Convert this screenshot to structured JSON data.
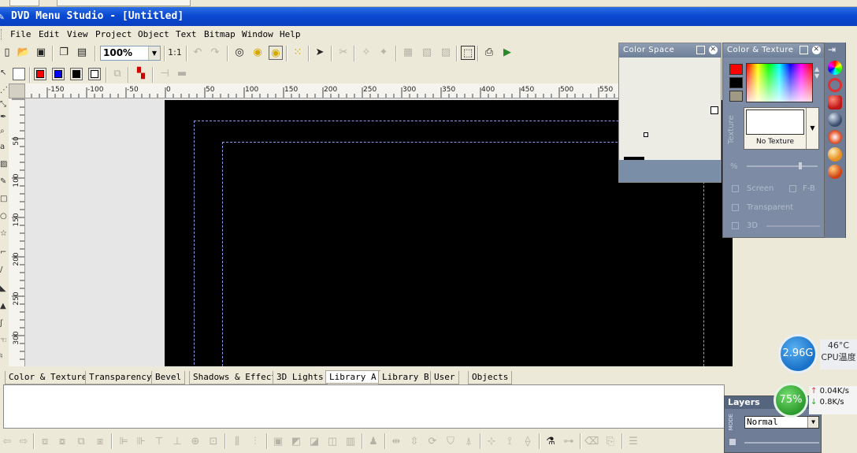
{
  "window": {
    "title": "DVD Menu Studio - [Untitled]"
  },
  "menu": [
    "File",
    "Edit",
    "View",
    "Project",
    "Object",
    "Text",
    "Bitmap",
    "Window",
    "Help"
  ],
  "toolbar1": {
    "zoom_value": "100%",
    "one_to_one_label": "1:1",
    "icons": [
      "new-icon",
      "open-icon",
      "save-icon",
      "copy-icon",
      "paste-icon",
      "undo-icon",
      "redo-icon",
      "circle-shape-icon",
      "circle-fill-icon",
      "circle-sel-icon",
      "grid-icon",
      "pointer-icon",
      "cut-object-icon",
      "magic-wand-icon",
      "magic-wand2-icon",
      "frame-icon",
      "frame2-icon",
      "frame3-icon",
      "select-frame-icon",
      "export-icon",
      "preview-icon"
    ]
  },
  "ruler": {
    "h_labels": [
      "-150",
      "-100",
      "-50",
      "0",
      "50",
      "100",
      "150",
      "200",
      "250",
      "300",
      "350",
      "400",
      "450",
      "500",
      "550"
    ],
    "v_labels": [
      "50",
      "100",
      "150",
      "200",
      "250",
      "300"
    ]
  },
  "colors": {
    "accent_title": "#0a49d2",
    "canvas_bg": "#000000",
    "safe_area": "#8e9ee8",
    "swatch_red": "#ff0000",
    "swatch_blue": "#0000ff",
    "swatch_black": "#000000",
    "swatch_white": "#ffffff"
  },
  "color_space_panel": {
    "title": "Color Space"
  },
  "color_texture_panel": {
    "title": "Color & Texture",
    "texture_label": "Texture",
    "texture_value": "No Texture",
    "percent_label": "%",
    "screen_label": "Screen",
    "fb_label": "F-B",
    "transparent_label": "Transparent",
    "threed_label": "3D"
  },
  "bottom_tabs": [
    "Color & Texture",
    "Transparency",
    "Bevel",
    "Shadows & Effect",
    "3D Lights",
    "Library A",
    "Library B",
    "User",
    "Objects"
  ],
  "active_bottom_tab": "Library A",
  "layers_panel": {
    "title": "Layers",
    "mode_label": "MODE",
    "mode_value": "Normal"
  },
  "system_monitor": {
    "cpu_freq": "2.96G",
    "temperature": "46°C",
    "temp_label": "CPU温度",
    "memory_percent": "75%",
    "upload": "0.04K/s",
    "download": "0.8K/s"
  }
}
